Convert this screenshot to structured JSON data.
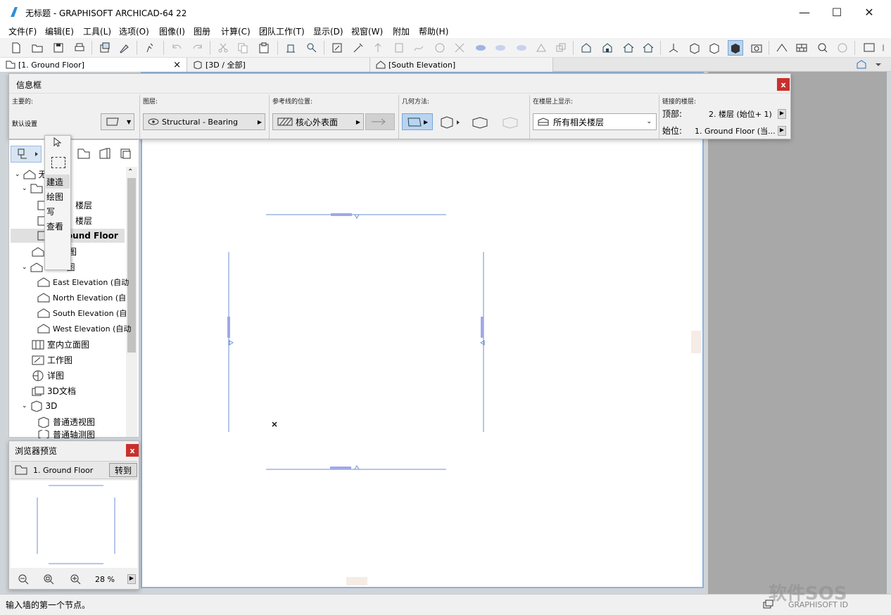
{
  "window": {
    "title": "无标题 - GRAPHISOFT ARCHICAD-64 22",
    "minimize": "—",
    "maximize": "☐",
    "close": "✕"
  },
  "menu": [
    "文件(F)",
    "编辑(E)",
    "工具(L)",
    "选项(O)",
    "图像(I)",
    "图册",
    "计算(C)",
    "团队工作(T)",
    "显示(D)",
    "视窗(W)",
    "附加",
    "帮助(H)"
  ],
  "tabs": [
    {
      "label": "[1. Ground Floor]",
      "close": "×"
    },
    {
      "label": "[3D / 全部]"
    },
    {
      "label": "[South Elevation]"
    }
  ],
  "infobox": {
    "title": "信息框",
    "close": "x",
    "main_label": "主要的:",
    "default_label": "默认设置",
    "layer_label": "图层:",
    "layer_value": "Structural - Bearing",
    "refline_label": "参考线的位置:",
    "refline_value": "核心外表面",
    "geometry_label": "几何方法:",
    "show_on_floors_label": "在楼层上显示:",
    "show_on_floors_value": "所有相关楼层",
    "linked_floors_label": "链接的楼层:",
    "top_label": "顶部:",
    "top_value": "2. 楼层 (始位+ 1)",
    "bottom_label": "始位:",
    "bottom_value": "1. Ground Floor (当..."
  },
  "popup": [
    "建造",
    "绘图",
    "写",
    "查看"
  ],
  "tree": {
    "root": "无",
    "story1": "楼层",
    "story2": "楼层",
    "ground": "round Floor",
    "section1": "图",
    "section2": "图",
    "elevations": [
      "East Elevation (自动",
      "North Elevation (自",
      "South Elevation (自",
      "West Elevation (自动"
    ],
    "interior": "室内立面图",
    "worksheet": "工作图",
    "detail": "详图",
    "doc3d": "3D文档",
    "group3d": "3D",
    "perspective": "普通透视图",
    "axon": "普通轴测图"
  },
  "preview": {
    "title": "浏览器预览",
    "close": "x",
    "view_name": "1. Ground Floor",
    "goto_button": "转到",
    "zoom": "28 %"
  },
  "status": {
    "message": "输入墙的第一个节点。",
    "brand": "GRAPHISOFT ID",
    "watermark": "软件SOS"
  },
  "colors": {
    "accent": "#7aa6d4",
    "close_red": "#c9302c",
    "wall_line": "#6b8fd6"
  }
}
